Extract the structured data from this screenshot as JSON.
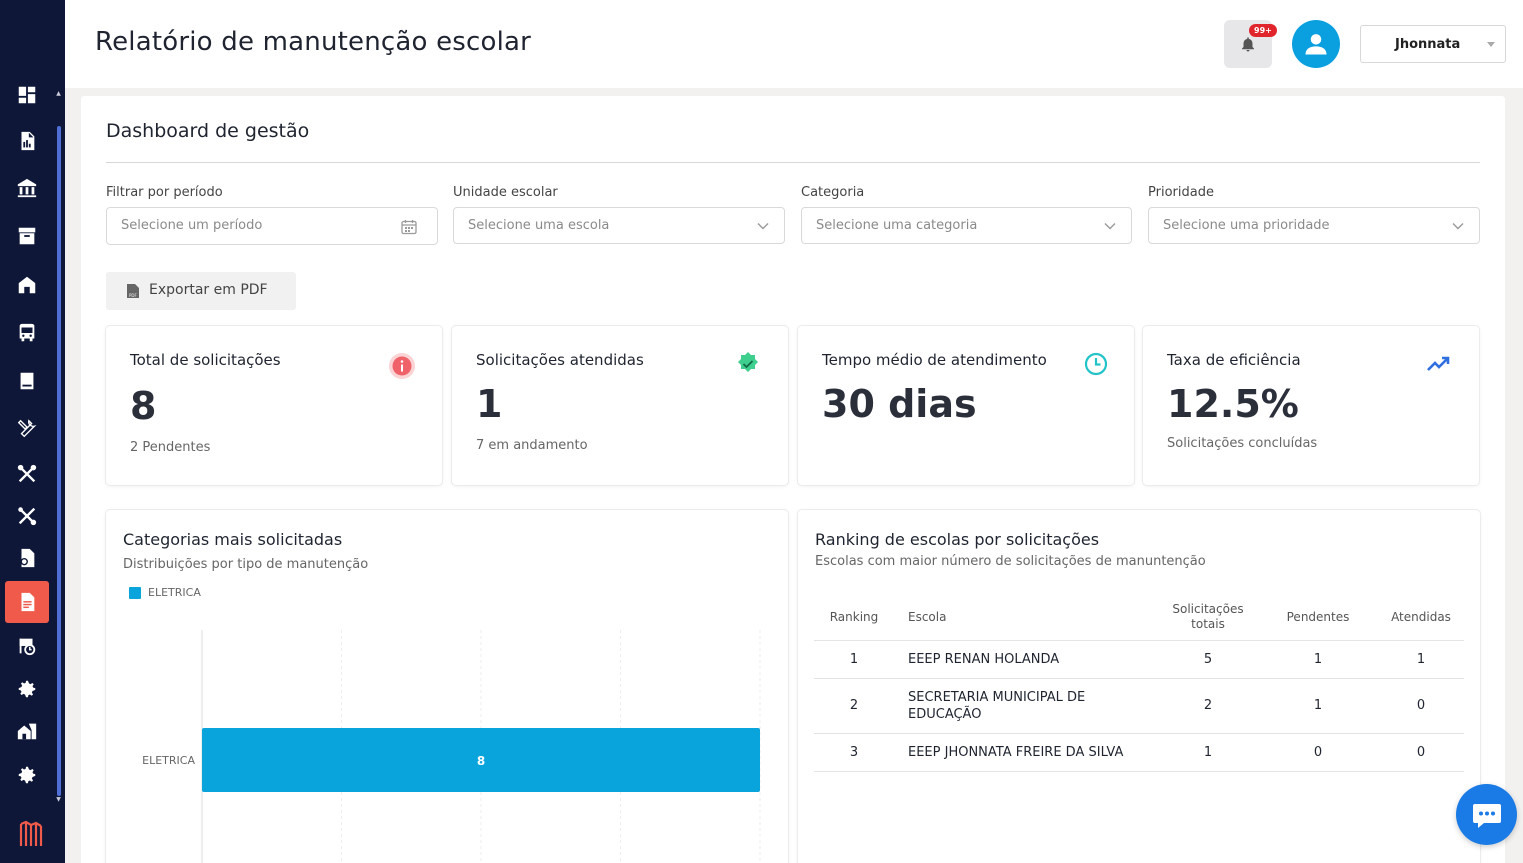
{
  "header": {
    "title": "Relatório de manutenção escolar",
    "notification_badge": "99+",
    "user_name": "Jhonnata"
  },
  "dashboard": {
    "title": "Dashboard de gestão",
    "filters": [
      {
        "label": "Filtrar por período",
        "placeholder": "Selecione um período",
        "icon": "calendar-icon"
      },
      {
        "label": "Unidade escolar",
        "placeholder": "Selecione uma escola",
        "icon": "chevron-down-icon"
      },
      {
        "label": "Categoria",
        "placeholder": "Selecione uma categoria",
        "icon": "chevron-down-icon"
      },
      {
        "label": "Prioridade",
        "placeholder": "Selecione uma prioridade",
        "icon": "chevron-down-icon"
      }
    ],
    "export_label": "Exportar em PDF",
    "stats": [
      {
        "title": "Total de solicitações",
        "value": "8",
        "sub": "2 Pendentes",
        "icon": "info-icon",
        "color": "#f0626a"
      },
      {
        "title": "Solicitações atendidas",
        "value": "1",
        "sub": "7 em andamento",
        "icon": "verified-check-icon",
        "color": "#3ecf8e"
      },
      {
        "title": "Tempo médio de atendimento",
        "value": "30 dias",
        "sub": "",
        "icon": "clock-icon",
        "color": "#22c3c8"
      },
      {
        "title": "Taxa de eficiência",
        "value": "12.5%",
        "sub": "Solicitações concluídas",
        "icon": "trending-up-icon",
        "color": "#2f6fe0"
      }
    ]
  },
  "categories_panel": {
    "title": "Categorias mais solicitadas",
    "subtitle": "Distribuições por tipo de manutenção"
  },
  "chart_data": {
    "type": "bar",
    "orientation": "horizontal",
    "categories": [
      "ELETRICA"
    ],
    "series": [
      {
        "name": "ELETRICA",
        "values": [
          8
        ],
        "color": "#0aa4dd"
      }
    ],
    "xlim": [
      0,
      8
    ],
    "grid": true,
    "legend": "top-left",
    "data_labels": [
      "8"
    ]
  },
  "ranking_panel": {
    "title": "Ranking de escolas por solicitações",
    "subtitle": "Escolas com maior número de solicitações de manuntenção",
    "columns": [
      "Ranking",
      "Escola",
      "Solicitações totais",
      "Pendentes",
      "Atendidas"
    ],
    "rows": [
      {
        "rank": "1",
        "school": "EEEP RENAN HOLANDA",
        "total": "5",
        "pending": "1",
        "done": "1"
      },
      {
        "rank": "2",
        "school": "SECRETARIA MUNICIPAL DE EDUCAÇÃO",
        "total": "2",
        "pending": "1",
        "done": "0"
      },
      {
        "rank": "3",
        "school": "EEEP JHONNATA FREIRE DA SILVA",
        "total": "1",
        "pending": "0",
        "done": "0"
      }
    ]
  },
  "sidebar": {
    "icons": [
      "dashboard-icon",
      "report-icon",
      "building-icon",
      "archive-icon",
      "school-icon",
      "bus-icon",
      "book-icon",
      "tools-icon",
      "wrench-icon",
      "tools-icon",
      "maintenance-report-icon",
      "document-icon",
      "schedule-icon",
      "gear-icon",
      "buildings-icon",
      "gear-icon"
    ],
    "active_color": "#ef5a4a"
  }
}
